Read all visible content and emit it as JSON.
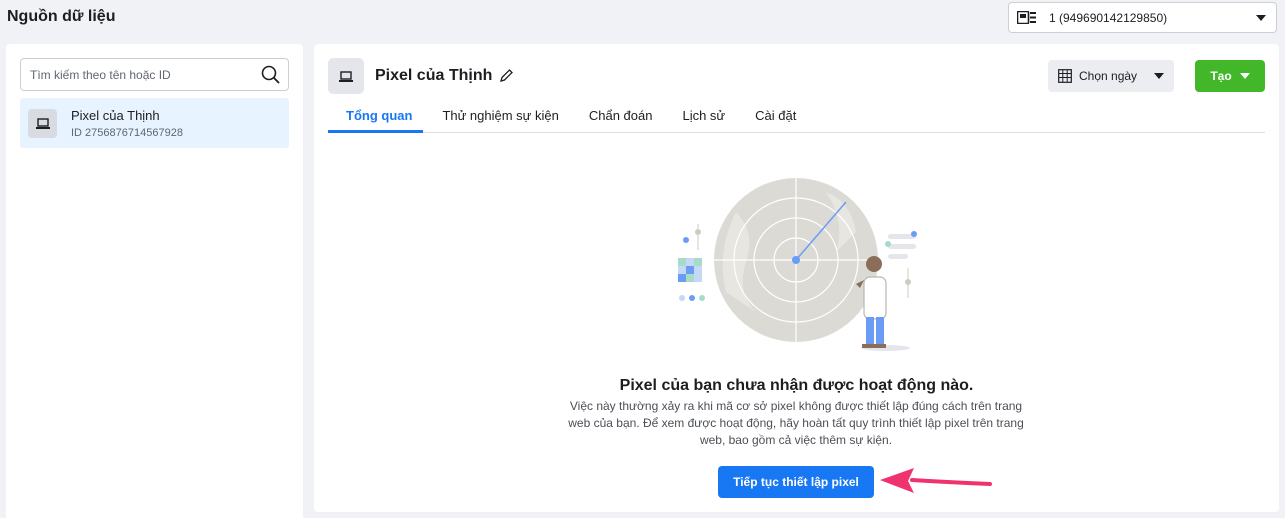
{
  "page": {
    "title": "Nguồn dữ liệu"
  },
  "account": {
    "label": "1 (949690142129850)",
    "icon": "business-account-icon"
  },
  "sidebar": {
    "search_placeholder": "Tìm kiếm theo tên hoặc ID",
    "items": [
      {
        "name": "Pixel của Thịnh",
        "id": "ID 2756876714567928",
        "icon": "laptop-icon"
      }
    ]
  },
  "main": {
    "title": "Pixel của Thịnh",
    "date_label": "Chọn ngày",
    "create_label": "Tạo",
    "tabs": [
      {
        "label": "Tổng quan",
        "active": true
      },
      {
        "label": "Thử nghiệm sự kiện",
        "active": false
      },
      {
        "label": "Chẩn đoán",
        "active": false
      },
      {
        "label": "Lịch sử",
        "active": false
      },
      {
        "label": "Cài đặt",
        "active": false
      }
    ],
    "empty": {
      "title": "Pixel của bạn chưa nhận được hoạt động nào.",
      "description": "Việc này thường xảy ra khi mã cơ sở pixel không được thiết lập đúng cách trên trang web của bạn. Để xem được hoạt động, hãy hoàn tất quy trình thiết lập pixel trên trang web, bao gồm cả việc thêm sự kiện.",
      "button": "Tiếp tục thiết lập pixel"
    }
  },
  "colors": {
    "primary": "#1877f2",
    "create": "#42b72a",
    "arrow": "#f0336e",
    "selected_bg": "#e7f3ff"
  }
}
